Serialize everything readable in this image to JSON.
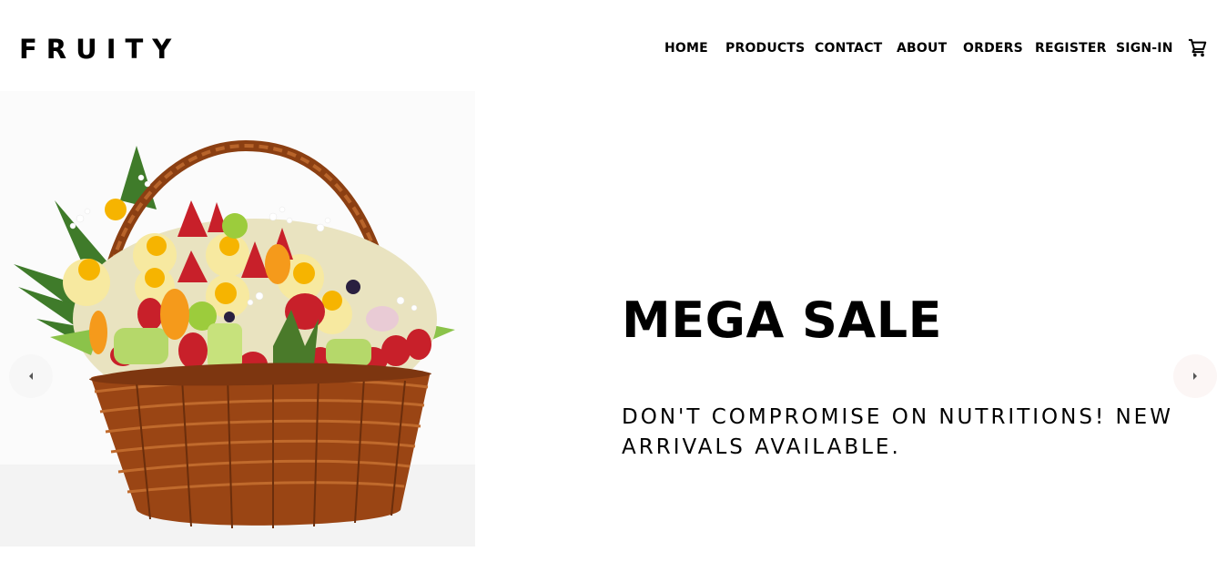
{
  "header": {
    "brand": "FRUITY",
    "nav": [
      {
        "label": "HOME"
      },
      {
        "label": "PRODUCTS"
      },
      {
        "label": "CONTACT"
      },
      {
        "label": "ABOUT"
      },
      {
        "label": "ORDERS"
      },
      {
        "label": "REGISTER"
      },
      {
        "label": "SIGN-IN"
      }
    ],
    "cart_icon": "shopping-cart-icon"
  },
  "hero": {
    "image_icon": "fruit-basket-image",
    "headline": "MEGA SALE",
    "subline": "DON'T COMPROMISE ON NUTRITIONS! NEW ARRIVALS AVAILABLE.",
    "prev_icon": "chevron-left-icon",
    "next_icon": "chevron-right-icon"
  },
  "colors": {
    "text": "#000000",
    "background": "#ffffff",
    "basket": "#9a4514",
    "strawberry": "#c8202a"
  }
}
